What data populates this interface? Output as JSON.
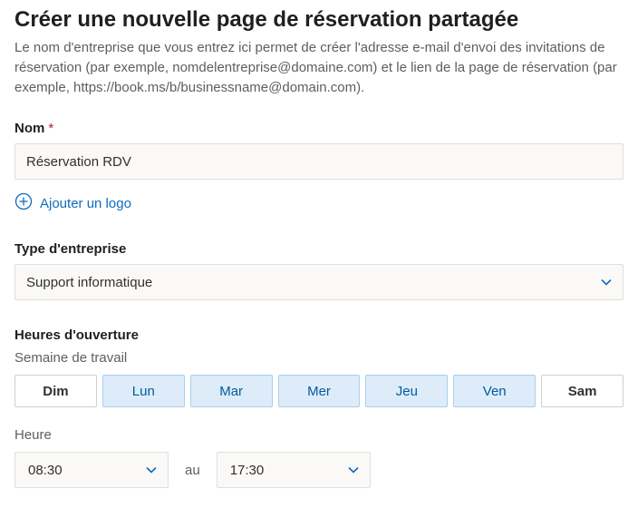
{
  "title": "Créer une nouvelle page de réservation partagée",
  "description": "Le nom d'entreprise que vous entrez ici permet de créer l'adresse e-mail d'envoi des invitations de réservation (par exemple, nomdelentreprise@domaine.com) et le lien de la page de réservation (par exemple, https://book.ms/b/businessname@domain.com).",
  "name": {
    "label": "Nom",
    "required_mark": "*",
    "value": "Réservation RDV"
  },
  "add_logo_label": "Ajouter un logo",
  "business_type": {
    "label": "Type d'entreprise",
    "value": "Support informatique"
  },
  "hours": {
    "label": "Heures d'ouverture",
    "week_label": "Semaine de travail",
    "days": [
      {
        "short": "Dim",
        "active": false
      },
      {
        "short": "Lun",
        "active": true
      },
      {
        "short": "Mar",
        "active": true
      },
      {
        "short": "Mer",
        "active": true
      },
      {
        "short": "Jeu",
        "active": true
      },
      {
        "short": "Ven",
        "active": true
      },
      {
        "short": "Sam",
        "active": false
      }
    ],
    "time_label": "Heure",
    "start": "08:30",
    "separator": "au",
    "end": "17:30"
  }
}
